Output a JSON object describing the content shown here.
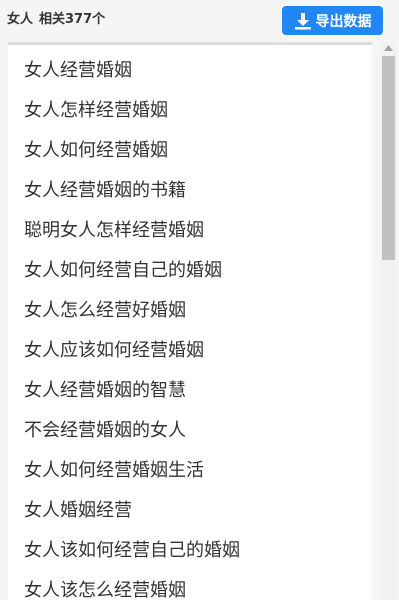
{
  "header": {
    "keyword": "女人",
    "count_text": "相关377个",
    "export_label": "导出数据"
  },
  "colors": {
    "accent": "#2187f7",
    "text": "#333333",
    "background": "#f5f5f5"
  },
  "icons": {
    "export": "download-icon",
    "scroll_up": "scroll-up-arrow-icon"
  },
  "results": [
    "女人经营婚姻",
    "女人怎样经营婚姻",
    "女人如何经营婚姻",
    "女人经营婚姻的书籍",
    "聪明女人怎样经营婚姻",
    "女人如何经营自己的婚姻",
    "女人怎么经营好婚姻",
    "女人应该如何经营婚姻",
    "女人经营婚姻的智慧",
    "不会经营婚姻的女人",
    "女人如何经营婚姻生活",
    "女人婚姻经营",
    "女人该如何经营自己的婚姻",
    "女人该怎么经营婚姻"
  ]
}
